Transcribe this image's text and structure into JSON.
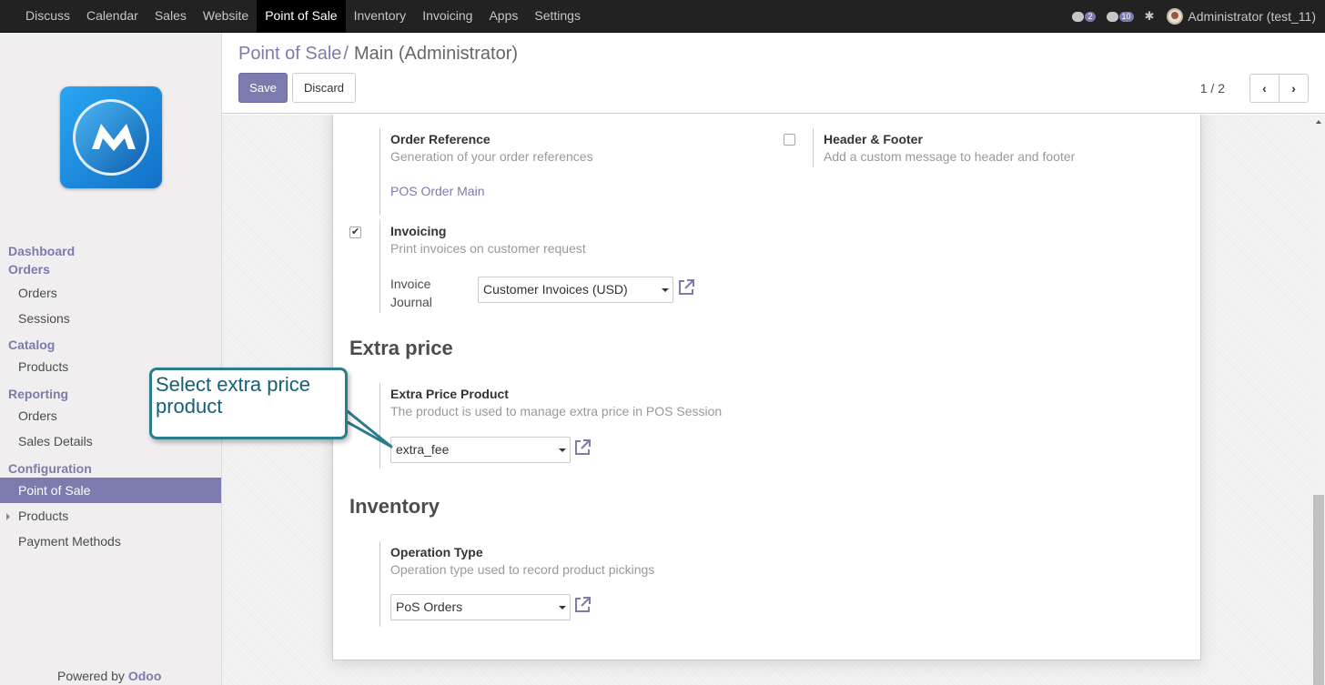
{
  "topbar": {
    "menu": [
      "Discuss",
      "Calendar",
      "Sales",
      "Website",
      "Point of Sale",
      "Inventory",
      "Invoicing",
      "Apps",
      "Settings"
    ],
    "active_menu": "Point of Sale",
    "chat_count": "2",
    "message_count": "10",
    "user": "Administrator (test_11)"
  },
  "sidebar": {
    "sections": [
      {
        "title": "Dashboard"
      },
      {
        "title": "Orders",
        "items": [
          "Orders",
          "Sessions"
        ]
      },
      {
        "title": "Catalog",
        "items": [
          "Products"
        ]
      },
      {
        "title": "Reporting",
        "items": [
          "Orders",
          "Sales Details"
        ]
      },
      {
        "title": "Configuration",
        "items": [
          "Point of Sale",
          "Products",
          "Payment Methods"
        ]
      }
    ],
    "active_item": "Point of Sale",
    "powered_by": "Powered by",
    "powered_brand": "Odoo"
  },
  "control_panel": {
    "breadcrumb_parent": "Point of Sale",
    "breadcrumb_sep": "/",
    "breadcrumb_current": "Main (Administrator)",
    "save_label": "Save",
    "discard_label": "Discard",
    "pager": "1 / 2"
  },
  "form": {
    "order_reference": {
      "title": "Order Reference",
      "desc": "Generation of your order references",
      "link": "POS Order Main"
    },
    "header_footer": {
      "title": "Header & Footer",
      "desc": "Add a custom message to header and footer",
      "checked": false
    },
    "invoicing": {
      "title": "Invoicing",
      "desc": "Print invoices on customer request",
      "checked": true,
      "journal_label_1": "Invoice",
      "journal_label_2": "Journal",
      "journal_value": "Customer Invoices (USD)"
    },
    "extra_price_section": "Extra price",
    "extra_price": {
      "title": "Extra Price Product",
      "desc": "The product is used to manage extra price in POS Session",
      "value": "extra_fee"
    },
    "inventory_section": "Inventory",
    "operation_type": {
      "title": "Operation Type",
      "desc": "Operation type used to record product pickings",
      "value": "PoS Orders"
    }
  },
  "callout": {
    "text": "Select extra price product"
  },
  "colors": {
    "brand": "#7c7bad",
    "topbar": "#222222",
    "callout_border": "#2b7d8e"
  }
}
